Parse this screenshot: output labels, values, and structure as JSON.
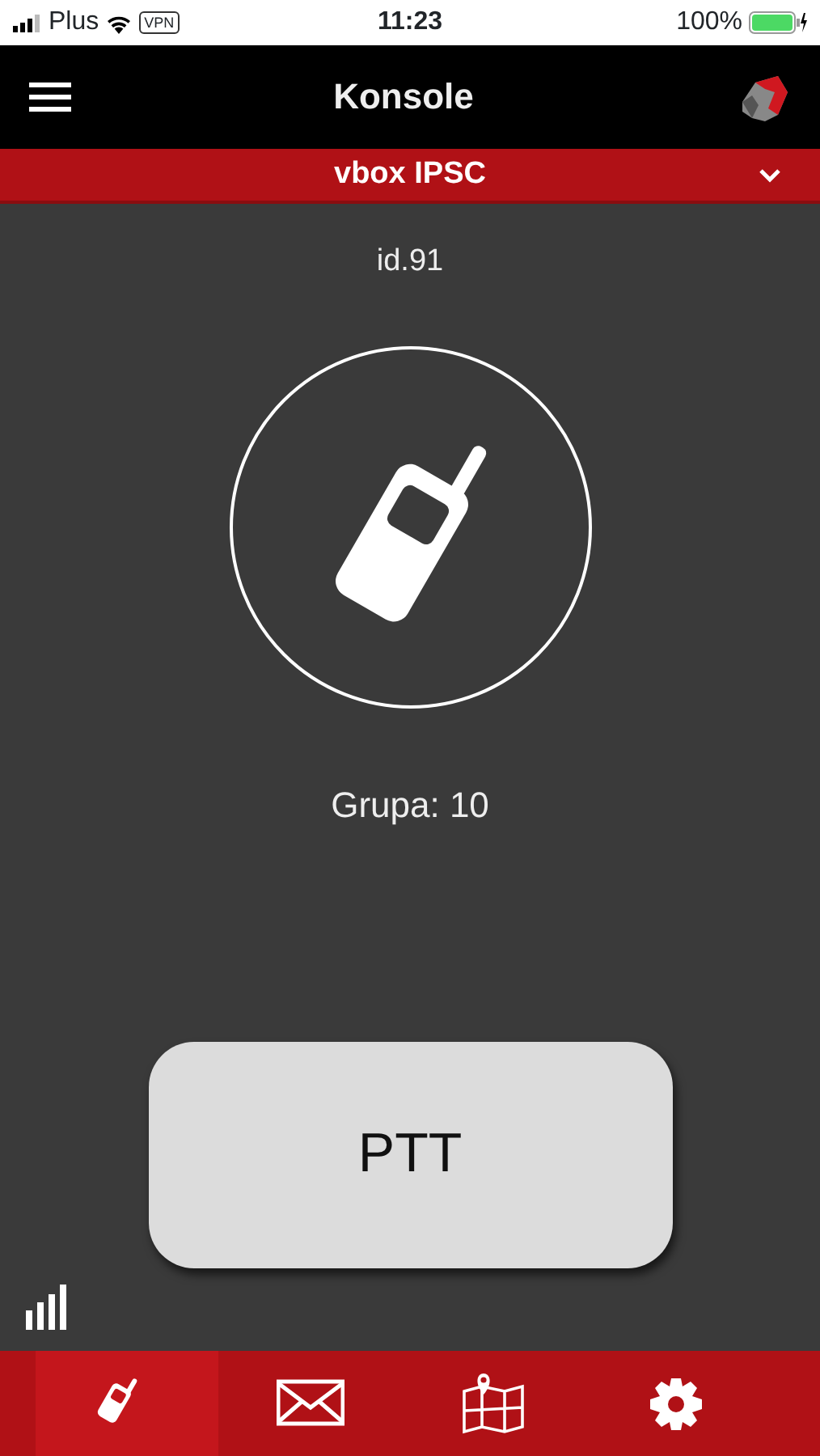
{
  "status_bar": {
    "carrier": "Plus",
    "vpn": "VPN",
    "time": "11:23",
    "battery": "100%",
    "battery_meter": {
      "level": 1
    }
  },
  "header": {
    "title": "Konsole"
  },
  "channel_bar": {
    "label": "vbox IPSC"
  },
  "device": {
    "id": "id.91",
    "group": "Grupa: 10"
  },
  "ptt_button": {
    "label": "PTT"
  },
  "tabs": [
    {
      "kind": "radio",
      "selected": true
    },
    {
      "kind": "mail",
      "selected": false
    },
    {
      "kind": "map",
      "selected": false
    },
    {
      "kind": "settings",
      "selected": false
    }
  ]
}
